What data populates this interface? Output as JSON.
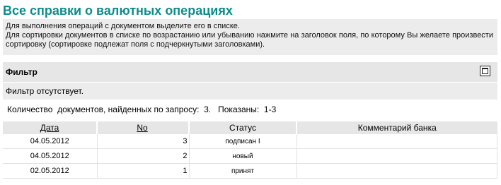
{
  "page": {
    "title": "Все справки о валютных операциях"
  },
  "info": {
    "line1": "Для выполнения операций с документом выделите его в списке.",
    "line2": "Для сортировки документов в списке по возрастанию или убыванию нажмите на заголовок поля, по которому Вы желаете произвести сортировку (сортировке подлежат поля с подчеркнутыми заголовками)."
  },
  "filter": {
    "title": "Фильтр",
    "expand_icon": "maximize-icon",
    "status_text": "Фильтр отсутствует."
  },
  "summary": {
    "label": "Количество  документов, найденных по запросу:",
    "found": "3.",
    "shown_label": "Показаны:",
    "shown_range": "1-3"
  },
  "table": {
    "headers": {
      "date": "Дата",
      "no": "No",
      "status": "Статус",
      "comment": "Комментарий банка"
    },
    "rows": [
      {
        "date": "04.05.2012",
        "no": "3",
        "status": "подписан I",
        "comment": ""
      },
      {
        "date": "04.05.2012",
        "no": "2",
        "status": "новый",
        "comment": ""
      },
      {
        "date": "02.05.2012",
        "no": "1",
        "status": "принят",
        "comment": ""
      }
    ]
  },
  "colors": {
    "title": "#0c8c8c",
    "panel_bg": "#ececec"
  }
}
